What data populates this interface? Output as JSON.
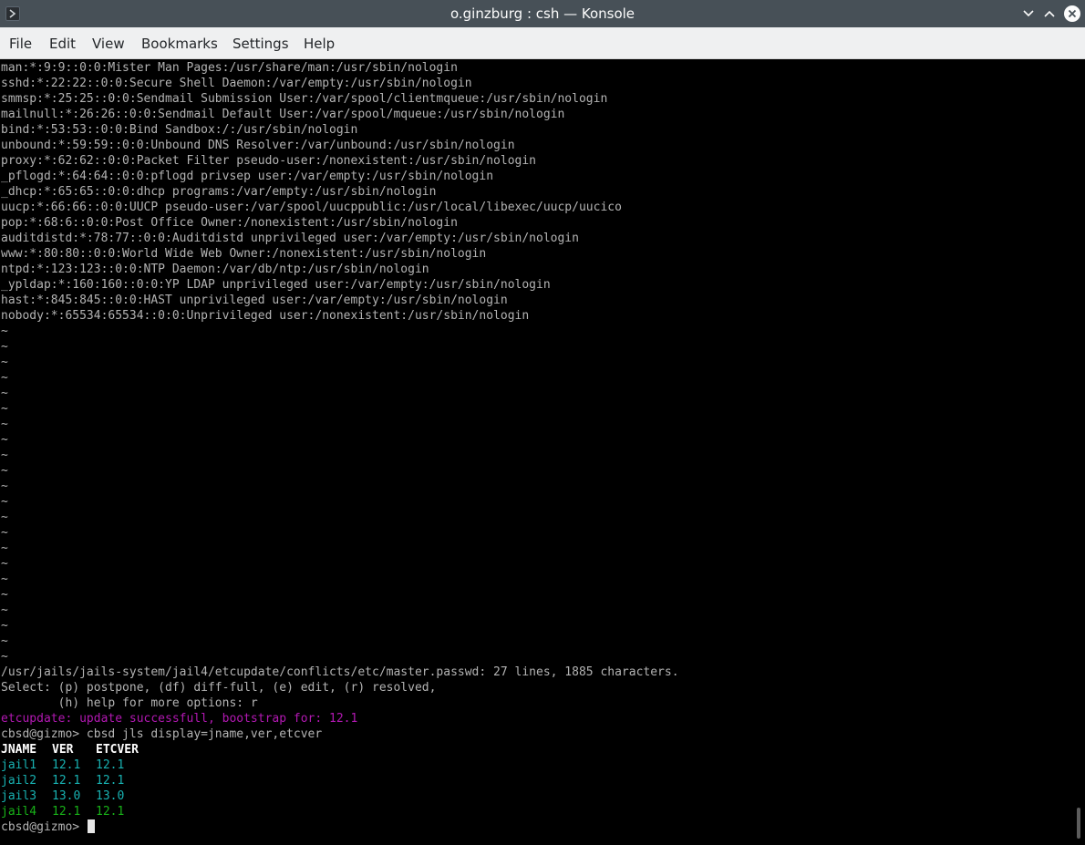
{
  "window": {
    "title": "o.ginzburg : csh — Konsole"
  },
  "menu": [
    "File",
    "Edit",
    "View",
    "Bookmarks",
    "Settings",
    "Help"
  ],
  "terminal": {
    "file_lines": [
      "man:*:9:9::0:0:Mister Man Pages:/usr/share/man:/usr/sbin/nologin",
      "sshd:*:22:22::0:0:Secure Shell Daemon:/var/empty:/usr/sbin/nologin",
      "smmsp:*:25:25::0:0:Sendmail Submission User:/var/spool/clientmqueue:/usr/sbin/nologin",
      "mailnull:*:26:26::0:0:Sendmail Default User:/var/spool/mqueue:/usr/sbin/nologin",
      "bind:*:53:53::0:0:Bind Sandbox:/:/usr/sbin/nologin",
      "unbound:*:59:59::0:0:Unbound DNS Resolver:/var/unbound:/usr/sbin/nologin",
      "proxy:*:62:62::0:0:Packet Filter pseudo-user:/nonexistent:/usr/sbin/nologin",
      "_pflogd:*:64:64::0:0:pflogd privsep user:/var/empty:/usr/sbin/nologin",
      "_dhcp:*:65:65::0:0:dhcp programs:/var/empty:/usr/sbin/nologin",
      "uucp:*:66:66::0:0:UUCP pseudo-user:/var/spool/uucppublic:/usr/local/libexec/uucp/uucico",
      "pop:*:68:6::0:0:Post Office Owner:/nonexistent:/usr/sbin/nologin",
      "auditdistd:*:78:77::0:0:Auditdistd unprivileged user:/var/empty:/usr/sbin/nologin",
      "www:*:80:80::0:0:World Wide Web Owner:/nonexistent:/usr/sbin/nologin",
      "ntpd:*:123:123::0:0:NTP Daemon:/var/db/ntp:/usr/sbin/nologin",
      "_ypldap:*:160:160::0:0:YP LDAP unprivileged user:/var/empty:/usr/sbin/nologin",
      "hast:*:845:845::0:0:HAST unprivileged user:/var/empty:/usr/sbin/nologin",
      "nobody:*:65534:65534::0:0:Unprivileged user:/nonexistent:/usr/sbin/nologin"
    ],
    "tilde": "~",
    "status_line": "/usr/jails/jails-system/jail4/etcupdate/conflicts/etc/master.passwd: 27 lines, 1885 characters.",
    "select_line": "Select: (p) postpone, (df) diff-full, (e) edit, (r) resolved,",
    "help_line": "        (h) help for more options: r",
    "etcupdate_msg": "etcupdate: update successfull, bootstrap for: 12.1",
    "command_line": "cbsd@gizmo> cbsd jls display=jname,ver,etcver",
    "table_headers": [
      "JNAME",
      "VER",
      "ETCVER"
    ],
    "table_rows": [
      {
        "jname": "jail1",
        "ver": "12.1",
        "etcver": "12.1",
        "color": "#18b2b2"
      },
      {
        "jname": "jail2",
        "ver": "12.1",
        "etcver": "12.1",
        "color": "#18b2b2"
      },
      {
        "jname": "jail3",
        "ver": "13.0",
        "etcver": "13.0",
        "color": "#18b2b2"
      },
      {
        "jname": "jail4",
        "ver": "12.1",
        "etcver": "12.1",
        "color": "#18b218"
      }
    ],
    "prompt": "cbsd@gizmo> "
  }
}
